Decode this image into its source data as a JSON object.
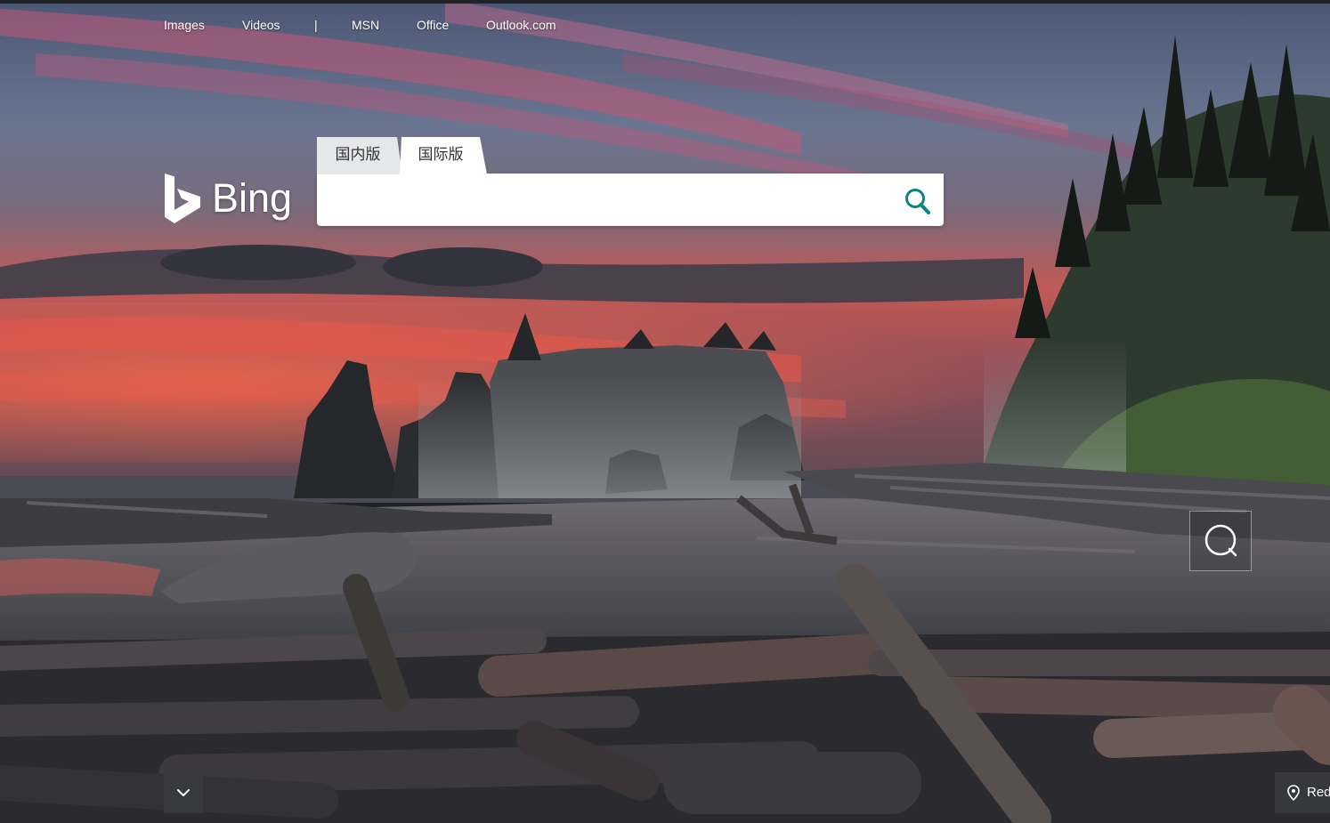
{
  "nav": {
    "images": "Images",
    "videos": "Videos",
    "separator": "|",
    "msn": "MSN",
    "office": "Office",
    "outlook": "Outlook.com"
  },
  "logo": {
    "text": "Bing"
  },
  "tabs": {
    "domestic": "国内版",
    "international": "国际版",
    "active": "international"
  },
  "search": {
    "value": "",
    "placeholder": ""
  },
  "image_search_hotspot": {
    "icon": "search-icon"
  },
  "scroll_button": {
    "icon": "chevron-down-icon"
  },
  "location": {
    "icon": "map-pin-icon",
    "label": "Red"
  },
  "colors": {
    "accent": "#0c8484",
    "tab_active": "#ffffff",
    "tab_inactive": "#e6e7e9",
    "chip_bg": "#37393e"
  }
}
